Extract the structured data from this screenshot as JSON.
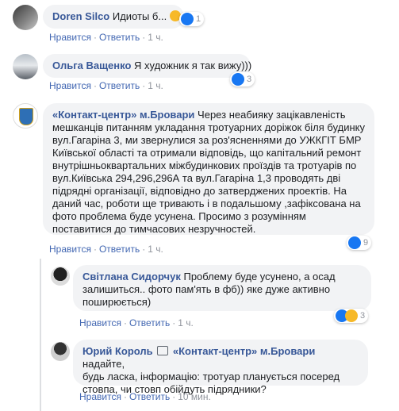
{
  "comments": [
    {
      "author": "Doren Silco",
      "text": "Идиоты б...",
      "like": "Нравится",
      "reply": "Ответить",
      "time": "1 ч.",
      "reactions": "1"
    },
    {
      "author": "Ольга Ващенко",
      "text": "Я художник я так вижу)))",
      "like": "Нравится",
      "reply": "Ответить",
      "time": "1 ч.",
      "reactions": "3"
    },
    {
      "author": "«Контакт-центр» м.Бровари",
      "text_lines": [
        "Через неабияку зацікавленість",
        "мешканців питанням укладання тротуарних доріжок біля будинку",
        "вул.Гагаріна 3, ми звернулися за роз'ясненнями до УЖКГІТ БМР",
        "Київської області та отримали відповідь, що капітальний ремонт",
        "внутрішньоквартальних міжбудинкових проїздів та тротуарів по",
        "вул.Київська 294,296,296А та вул.Гагаріна 1,3 проводять дві",
        "підрядні організації, відповідно до затверджених проектів. На",
        "даний час, роботи ще тривають і в подальшому ,зафіксована на",
        "фото проблема буде усунена. Просимо з розумінням",
        "поставитися до тимчасових незручностей."
      ],
      "like": "Нравится",
      "reply": "Ответить",
      "time": "1 ч.",
      "reactions": "9"
    },
    {
      "author": "Світлана Сидорчук",
      "text_lines": [
        "Проблему буде усунено, а осад",
        "залишиться.. фото пам'ять в фб)) яке дуже активно",
        "поширюється)"
      ],
      "like": "Нравится",
      "reply": "Ответить",
      "time": "1 ч.",
      "reactions": "3"
    },
    {
      "author": "Юрий Король",
      "mention": "«Контакт-центр» м.Бровари",
      "text_lines": [
        "надайте,",
        "будь ласка, інформацію: тротуар планується посеред",
        "стовпа, чи стовп обійдуть підрядники?"
      ],
      "like": "Нравится",
      "reply": "Ответить",
      "time": "10 мин."
    }
  ],
  "colors": {
    "link": "#385898",
    "action": "#4267b2",
    "bubble": "#f2f3f5",
    "like": "#1877f2",
    "haha": "#f7b928"
  }
}
